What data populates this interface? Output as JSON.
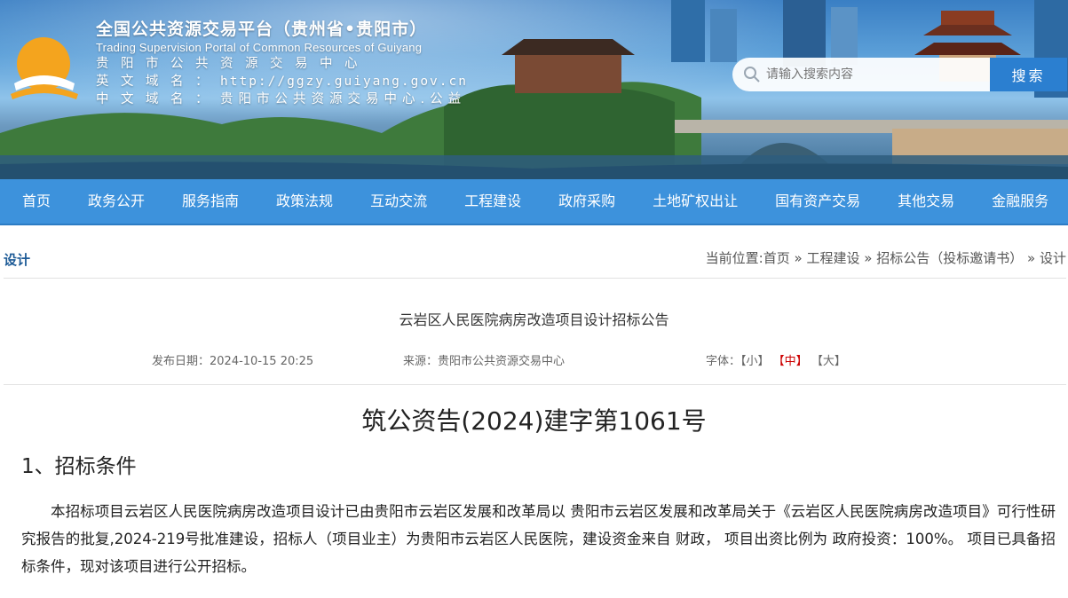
{
  "header": {
    "title": "全国公共资源交易平台（贵州省•贵阳市）",
    "subtitle_en": "Trading Supervision Portal of Common Resources of Guiyang",
    "center_name": "贵阳市公共资源交易中心",
    "en_domain_label": "英文域名：",
    "en_domain": "http://ggzy.guiyang.gov.cn",
    "cn_domain_label": "中文域名：",
    "cn_domain": "贵阳市公共资源交易中心.公益"
  },
  "search": {
    "placeholder": "请输入搜索内容",
    "button_label": "搜索"
  },
  "nav": {
    "items": [
      "首页",
      "政务公开",
      "服务指南",
      "政策法规",
      "互动交流",
      "工程建设",
      "政府采购",
      "土地矿权出让",
      "国有资产交易",
      "其他交易",
      "金融服务"
    ]
  },
  "location": {
    "category": "设计",
    "prefix": "当前位置:",
    "crumbs": [
      "首页",
      "工程建设",
      "招标公告（投标邀请书）",
      "设计"
    ],
    "separator": "»"
  },
  "article": {
    "title": "云岩区人民医院病房改造项目设计招标公告",
    "publish_label": "发布日期：",
    "publish_date": "2024-10-15 20:25",
    "source_label": "来源：",
    "source": "贵阳市公共资源交易中心",
    "font_label": "字体：",
    "font_small": "【小】",
    "font_medium": "【中】",
    "font_large": "【大】",
    "doc_number": "筑公资告(2024)建字第1061号",
    "section_heading": "1、招标条件",
    "paragraph": "本招标项目云岩区人民医院病房改造项目设计已由贵阳市云岩区发展和改革局以 贵阳市云岩区发展和改革局关于《云岩区人民医院病房改造项目》可行性研究报告的批复,2024-219号批准建设，招标人（项目业主）为贵阳市云岩区人民医院，建设资金来自 财政， 项目出资比例为 政府投资：100%。 项目已具备招标条件，现对该项目进行公开招标。"
  },
  "colors": {
    "nav_bg": "#3d92dc",
    "search_button": "#2b7fd0",
    "category_text": "#1c5a96",
    "font_active": "#cc0000"
  }
}
